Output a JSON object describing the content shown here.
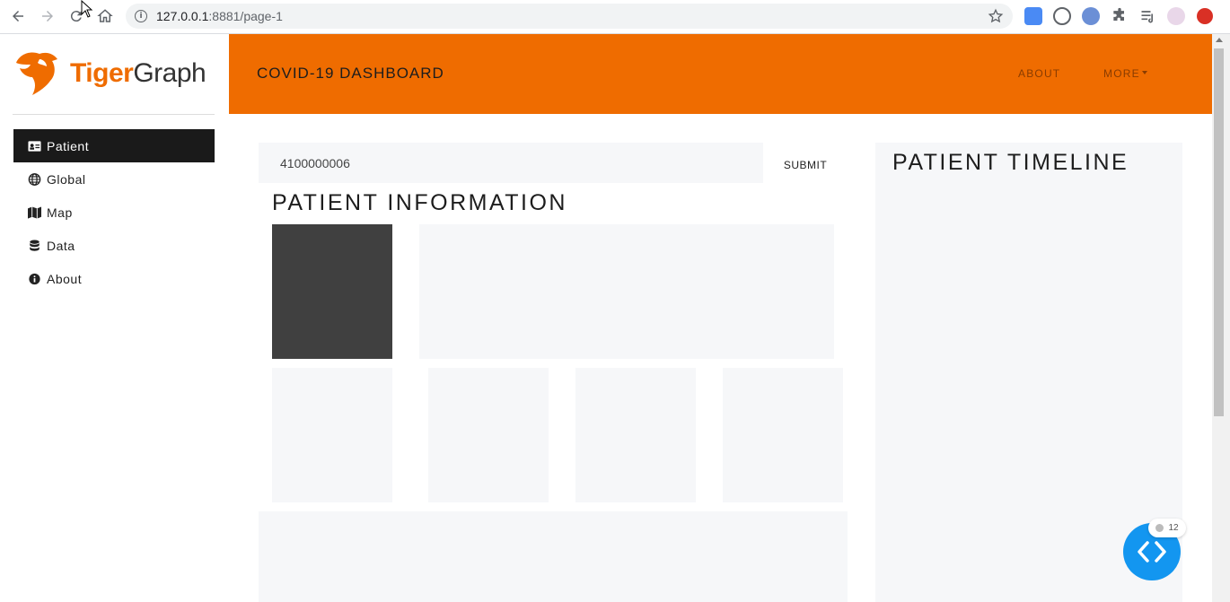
{
  "browser": {
    "url_host": "127.0.0.1",
    "url_rest": ":8881/page-1"
  },
  "brand": {
    "part1": "Tiger",
    "part2": "Graph",
    "accent_color": "#ef6c00"
  },
  "sidebar": {
    "items": [
      {
        "label": "Patient",
        "icon": "id-card-icon",
        "active": true
      },
      {
        "label": "Global",
        "icon": "globe-icon",
        "active": false
      },
      {
        "label": "Map",
        "icon": "map-icon",
        "active": false
      },
      {
        "label": "Data",
        "icon": "database-icon",
        "active": false
      },
      {
        "label": "About",
        "icon": "info-circle-icon",
        "active": false
      }
    ]
  },
  "header": {
    "title": "COVID-19 DASHBOARD",
    "nav": {
      "about": "ABOUT",
      "more": "MORE"
    }
  },
  "search": {
    "value": "4100000006",
    "submit_label": "SUBMIT"
  },
  "patient_info": {
    "title": "PATIENT INFORMATION"
  },
  "timeline": {
    "title": "PATIENT TIMELINE"
  },
  "fab": {
    "badge_count": "12",
    "color": "#1396f0"
  }
}
